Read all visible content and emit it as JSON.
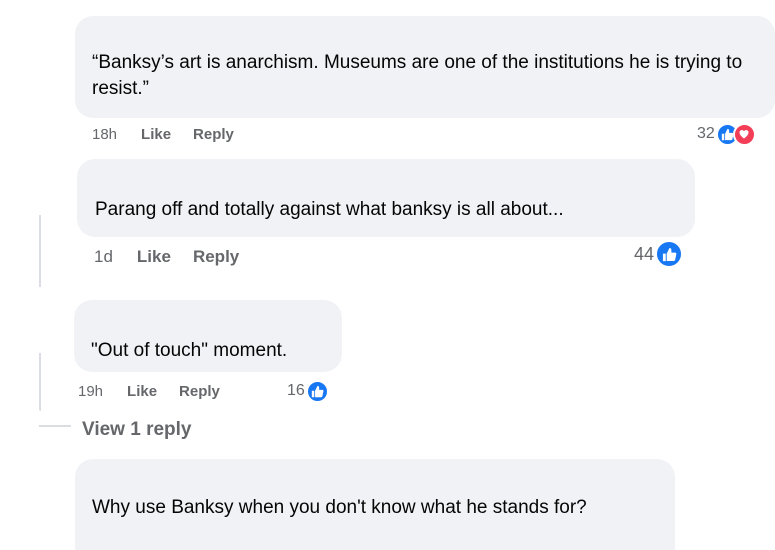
{
  "comments": [
    {
      "text": "“Banksy’s art is anarchism. Museums are one of the institutions he is trying to resist.”",
      "time": "18h",
      "like_label": "Like",
      "reply_label": "Reply",
      "reaction_count": "32",
      "reactions": [
        "like",
        "love"
      ]
    },
    {
      "text": "Parang off and totally against what banksy is all about...",
      "time": "1d",
      "like_label": "Like",
      "reply_label": "Reply",
      "reaction_count": "44",
      "reactions": [
        "like"
      ]
    },
    {
      "text": "\"Out of touch\" moment.",
      "time": "19h",
      "like_label": "Like",
      "reply_label": "Reply",
      "reaction_count": "16",
      "reactions": [
        "like"
      ],
      "view_replies_label": "View 1 reply"
    },
    {
      "text": "Why use Banksy when you don't know what he stands for?"
    }
  ],
  "colors": {
    "bubble": "#f0f2f5",
    "meta_text": "#65676b",
    "like": "#1877f2",
    "love": "#f33e58"
  }
}
